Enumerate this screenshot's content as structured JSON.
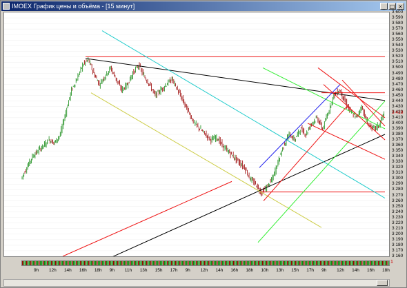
{
  "window": {
    "title": "IMOEX График цены и объёма - [15 минут]",
    "controls": [
      "_",
      "□",
      "×"
    ]
  },
  "chart_data": {
    "type": "line",
    "y_ticks": [
      3600,
      3590,
      3580,
      3570,
      3560,
      3550,
      3540,
      3530,
      3520,
      3510,
      3500,
      3490,
      3480,
      3470,
      3460,
      3450,
      3440,
      3430,
      3420,
      3410,
      3400,
      3390,
      3380,
      3370,
      3360,
      3350,
      3340,
      3330,
      3320,
      3310,
      3300,
      3290,
      3280,
      3270,
      3260,
      3250,
      3240,
      3230,
      3220,
      3210,
      3200,
      3190,
      3180,
      3170,
      3160
    ],
    "ylim": [
      3160,
      3600
    ],
    "current_price_label": "3 418",
    "current_price": 3418,
    "x_ticks_top": [
      "9h",
      "12h",
      "14h",
      "16h",
      "18h",
      "9h",
      "11h",
      "13h",
      "15h",
      "17h",
      "9h",
      "12h",
      "14h",
      "16h",
      "18h",
      "10h",
      "13h",
      "15h",
      "17h",
      "9h",
      "12h",
      "14h",
      "16h",
      "18h"
    ],
    "x_ticks_bottom": [
      "6",
      "11",
      "13",
      "15",
      "19",
      "21",
      "27",
      "29",
      "Feb",
      "3",
      "5",
      "9",
      "11"
    ],
    "price_series": [
      3300,
      3320,
      3340,
      3350,
      3360,
      3370,
      3365,
      3380,
      3420,
      3460,
      3480,
      3505,
      3515,
      3490,
      3470,
      3485,
      3500,
      3480,
      3460,
      3470,
      3490,
      3505,
      3485,
      3470,
      3450,
      3460,
      3470,
      3480,
      3460,
      3440,
      3420,
      3400,
      3390,
      3380,
      3370,
      3375,
      3360,
      3350,
      3340,
      3330,
      3320,
      3300,
      3290,
      3275,
      3285,
      3300,
      3330,
      3360,
      3380,
      3370,
      3390,
      3380,
      3400,
      3410,
      3390,
      3420,
      3450,
      3460,
      3440,
      3420,
      3410,
      3430,
      3400,
      3390,
      3395,
      3418
    ],
    "volume_panel_value": "1"
  },
  "colors": {
    "trend_black": "#000000",
    "trend_red": "#ee1111",
    "trend_cyan": "#22cccc",
    "trend_yellow": "#cccc44",
    "trend_green": "#33ee33",
    "trend_blue": "#2222ee",
    "candle_up": "#118811",
    "candle_down": "#990000"
  }
}
